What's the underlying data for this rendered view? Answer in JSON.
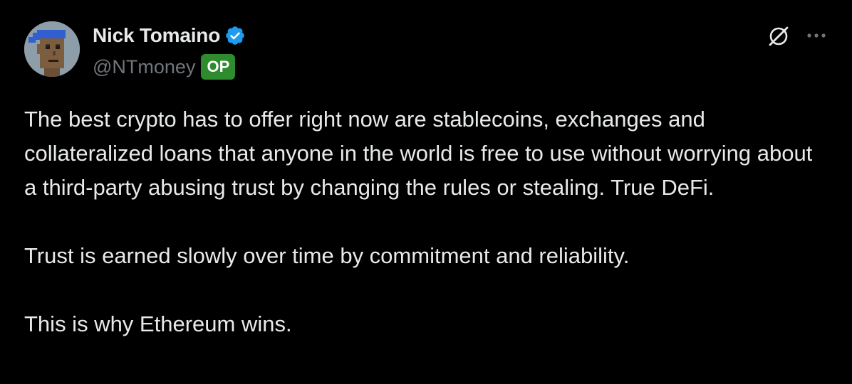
{
  "author": {
    "display_name": "Nick Tomaino",
    "handle": "@NTmoney",
    "badge": "OP",
    "verified": true,
    "avatar_icon": "cryptopunk-avatar"
  },
  "actions": {
    "grok_icon": "grok-icon",
    "more_icon": "more-options-icon"
  },
  "tweet": {
    "paragraphs": [
      "The best crypto has to offer right now are stablecoins, exchanges and collateralized loans that anyone in the world is free to use without worrying about a third-party abusing trust by changing the rules or stealing. True DeFi.",
      "Trust is earned slowly over time by commitment and reliability.",
      "This is why Ethereum wins."
    ]
  },
  "colors": {
    "background": "#000000",
    "text": "#e7e9ea",
    "muted": "#71767b",
    "verified_blue": "#1d9bf0",
    "op_green": "#2e8b2e"
  }
}
